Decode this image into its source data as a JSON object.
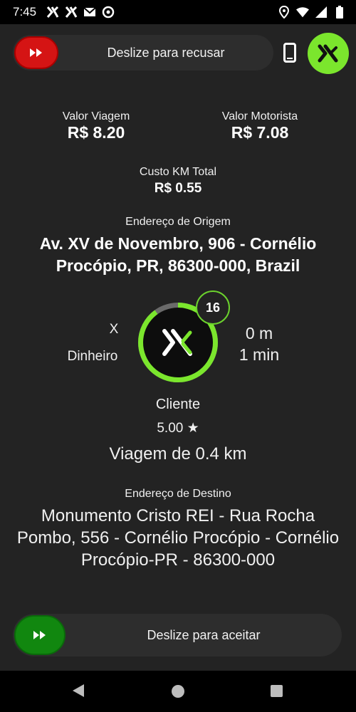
{
  "status_bar": {
    "time": "7:45",
    "left_icons": [
      "brand-notification-icon",
      "brand-notification-icon",
      "gmail-icon",
      "vpn-icon"
    ],
    "right_icons": [
      "location-icon",
      "wifi-icon",
      "signal-icon",
      "battery-icon"
    ]
  },
  "top": {
    "decline_label": "Deslize para recusar",
    "decline_color": "#d51414",
    "brand_color": "#7be62d"
  },
  "fares": {
    "trip_value_label": "Valor Viagem",
    "trip_value": "R$ 8.20",
    "driver_value_label": "Valor Motorista",
    "driver_value": "R$ 7.08",
    "km_cost_label": "Custo KM Total",
    "km_cost": "R$ 0.55"
  },
  "origin": {
    "label": "Endereço de Origem",
    "address": "Av. XV de Novembro, 906 - Cornélio Procópio, PR, 86300-000, Brazil"
  },
  "request": {
    "payment_x": "X",
    "payment_method": "Dinheiro",
    "countdown": "16",
    "countdown_fraction": 0.9,
    "distance": "0 m",
    "eta": "1 min"
  },
  "client": {
    "label": "Cliente",
    "rating": "5.00 ★",
    "trip": "Viagem de 0.4 km"
  },
  "destination": {
    "label": "Endereço de Destino",
    "address": "Monumento Cristo REI - Rua Rocha Pombo, 556 - Cornélio Procópio - Cornélio Procópio-PR - 86300-000"
  },
  "bottom": {
    "accept_label": "Deslize para aceitar",
    "accept_color": "#11870f"
  },
  "nav": {
    "icons": [
      "back-icon",
      "home-icon",
      "recents-icon"
    ]
  }
}
